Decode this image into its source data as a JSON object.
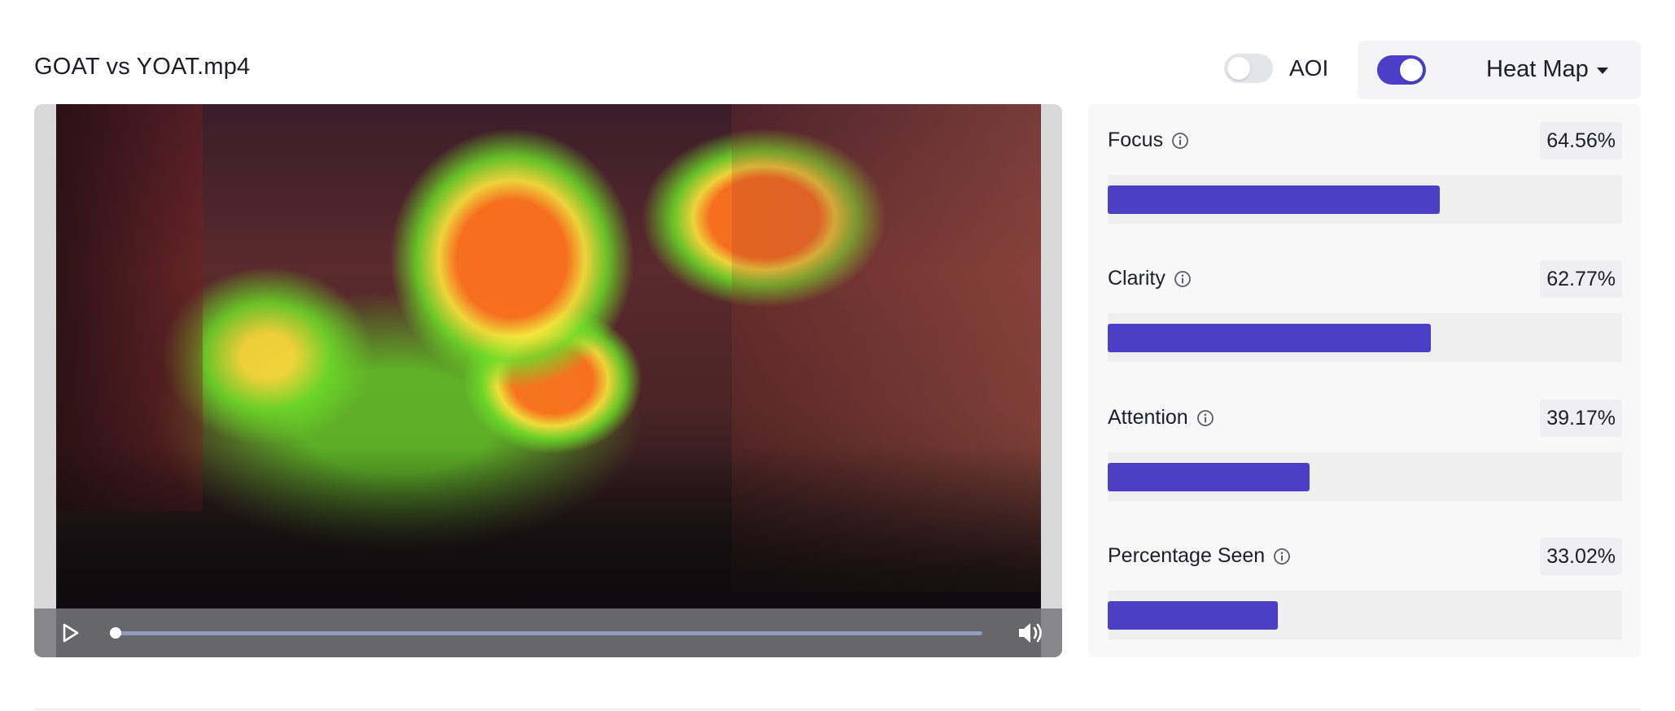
{
  "file": {
    "title": "GOAT vs YOAT.mp4"
  },
  "toolbar": {
    "aoi_label": "AOI",
    "aoi_enabled": false,
    "heatmap_enabled": true,
    "mode_label": "Heat Map"
  },
  "player": {
    "progress": 0.0,
    "buffered": 0.0
  },
  "metrics": [
    {
      "label": "Focus",
      "value": "64.56%",
      "fraction": 0.6456
    },
    {
      "label": "Clarity",
      "value": "62.77%",
      "fraction": 0.6277
    },
    {
      "label": "Attention",
      "value": "39.17%",
      "fraction": 0.3917
    },
    {
      "label": "Percentage Seen",
      "value": "33.02%",
      "fraction": 0.3302
    }
  ],
  "colors": {
    "accent": "#4b3fc5",
    "toggle_off": "#e3e4ea"
  }
}
